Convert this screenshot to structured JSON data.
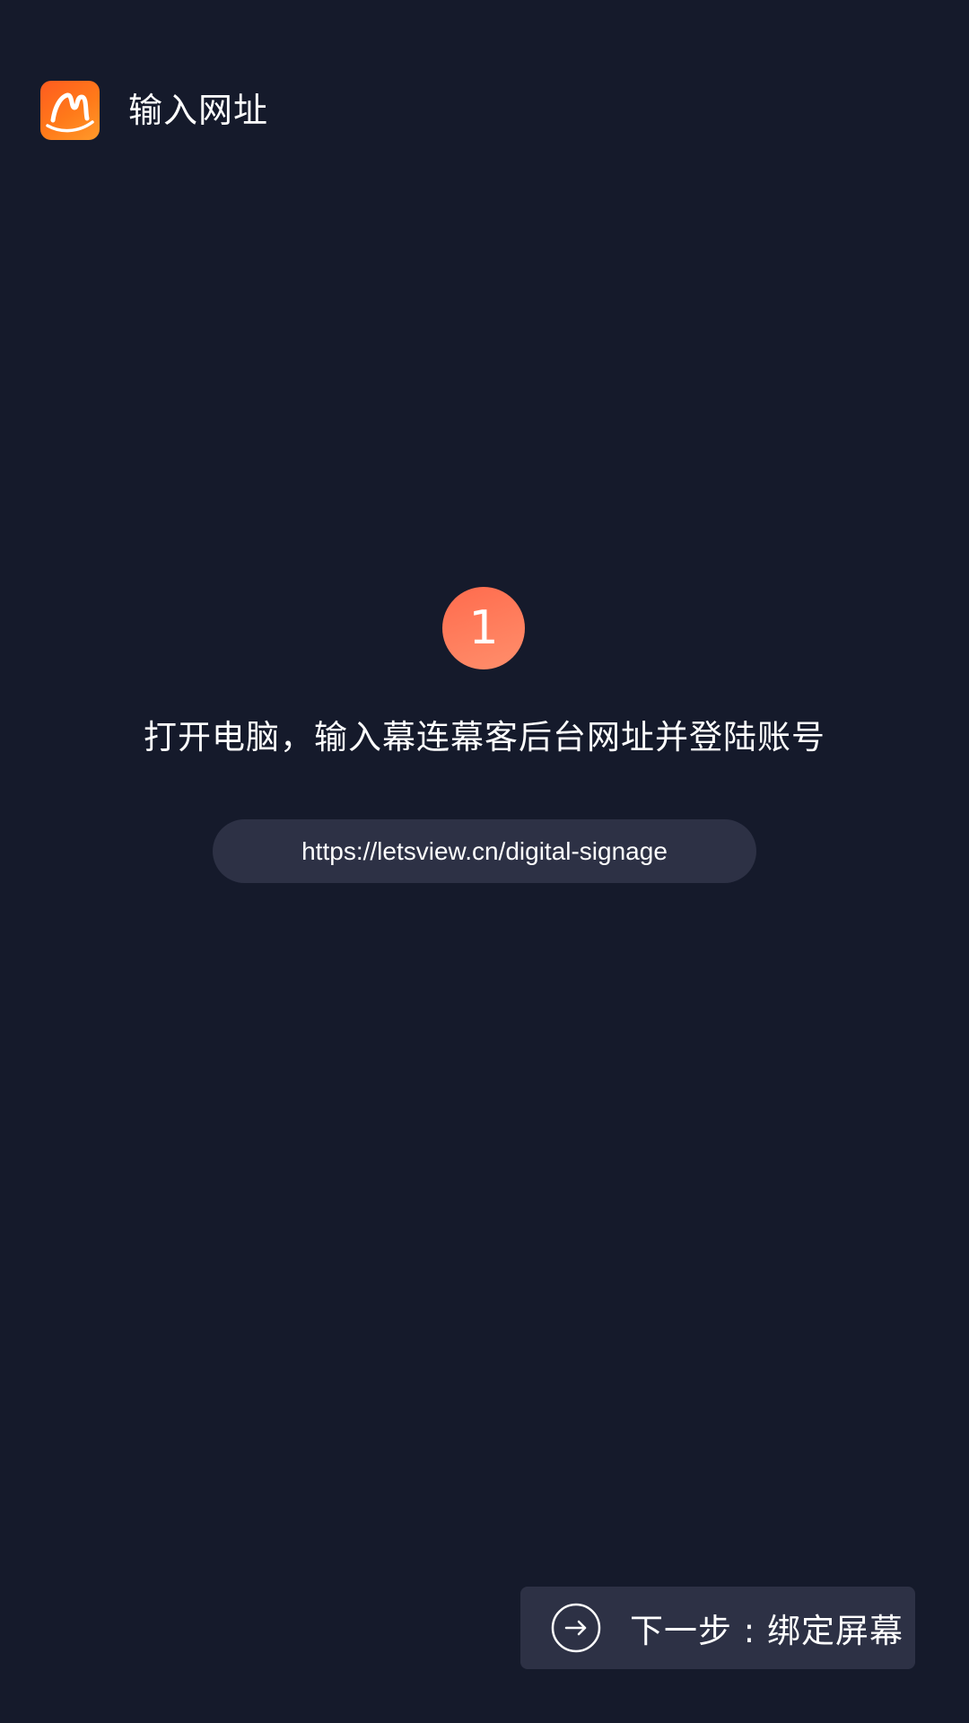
{
  "header": {
    "title": "输入网址",
    "logo_icon": "brand-logo-icon",
    "logo_color": "#ff6a1f"
  },
  "step": {
    "number": "1",
    "badge_color": "#ff7a5c",
    "instruction": "打开电脑，输入幕连幕客后台网址并登陆账号",
    "url": "https://letsview.cn/digital-signage"
  },
  "footer": {
    "next_label": "下一步 : 绑定屏幕",
    "next_icon": "arrow-right-circle-icon"
  },
  "colors": {
    "background": "#151a2b",
    "surface": "#2d3145",
    "text": "#ffffff"
  }
}
